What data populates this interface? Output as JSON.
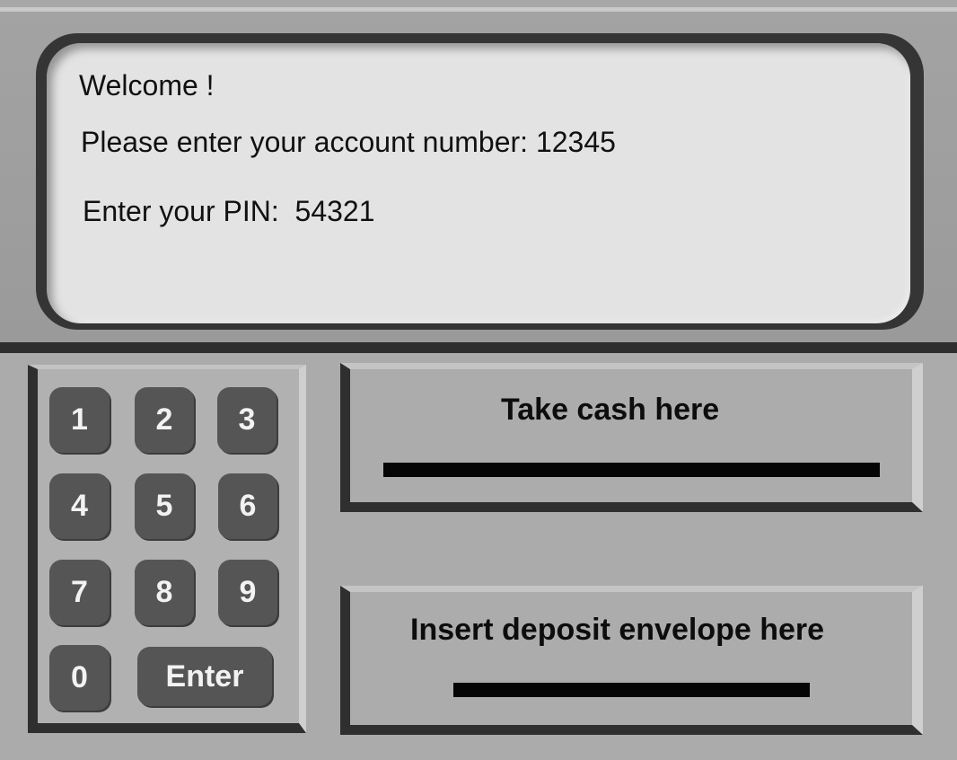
{
  "screen": {
    "welcome": "Welcome !",
    "account_line": "Please enter your account number: 12345",
    "pin_line": "Enter your PIN:  54321"
  },
  "keypad": {
    "keys": [
      "1",
      "2",
      "3",
      "4",
      "5",
      "6",
      "7",
      "8",
      "9",
      "0"
    ],
    "enter_label": "Enter"
  },
  "cash_dispenser": {
    "label": "Take cash here"
  },
  "deposit_slot": {
    "label": "Insert deposit envelope here"
  },
  "colors": {
    "background": "#ababab",
    "screen": "#e3e3e3",
    "key": "#555555",
    "key_text": "#f2f2f2",
    "slot": "#050505"
  }
}
